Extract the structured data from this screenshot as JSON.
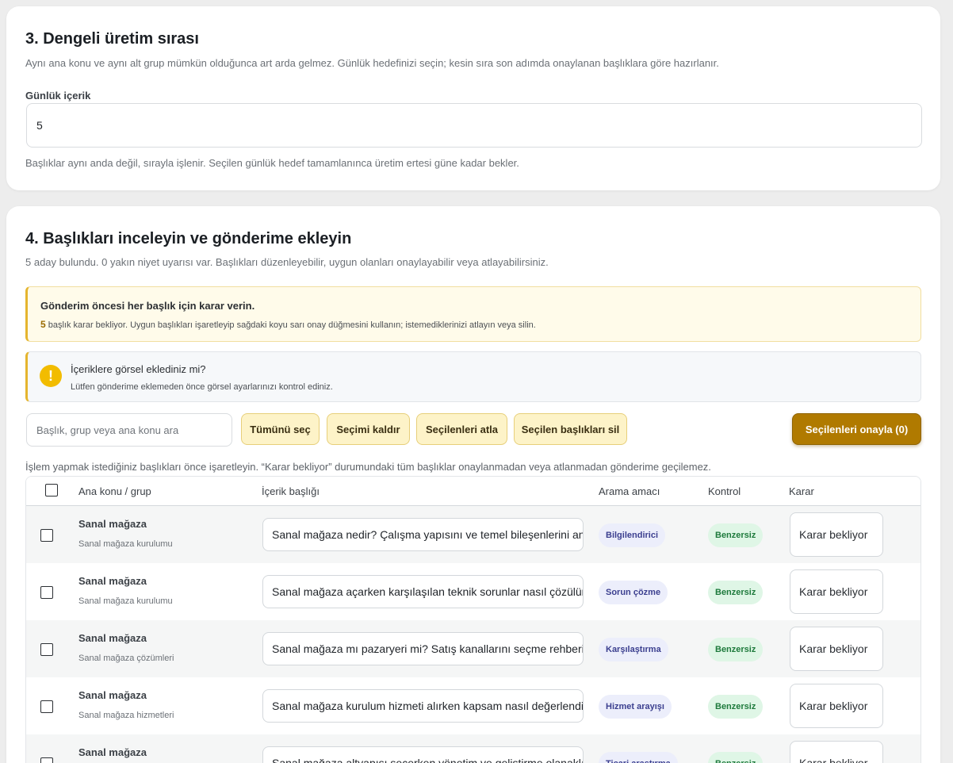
{
  "section3": {
    "title": "3. Dengeli üretim sırası",
    "description": "Aynı ana konu ve aynı alt grup mümkün olduğunca art arda gelmez. Günlük hedefinizi seçin; kesin sıra son adımda onaylanan başlıklara göre hazırlanır.",
    "daily_label": "Günlük içerik",
    "daily_value": "5",
    "note": "Başlıklar aynı anda değil, sırayla işlenir. Seçilen günlük hedef tamamlanınca üretim ertesi güne kadar bekler."
  },
  "section4": {
    "title": "4. Başlıkları inceleyin ve gönderime ekleyin",
    "description": "5 aday bulundu. 0 yakın niyet uyarısı var. Başlıkları düzenleyebilir, uygun olanları onaylayabilir veya atlayabilirsiniz.",
    "warning": {
      "title": "Gönderim öncesi her başlık için karar verin.",
      "count": "5",
      "text": "başlık karar bekliyor. Uygun başlıkları işaretleyip sağdaki koyu sarı onay düğmesini kullanın; istemediklerinizi atlayın veya silin."
    },
    "info": {
      "icon": "exclamation-icon",
      "title": "İçeriklere görsel eklediniz mi?",
      "text": "Lütfen gönderime eklemeden önce görsel ayarlarınızı kontrol ediniz."
    },
    "search_placeholder": "Başlık, grup veya ana konu ara",
    "buttons": {
      "select_all": "Tümünü seç",
      "clear_selection": "Seçimi kaldır",
      "skip_selected": "Seçilenleri atla",
      "delete_selected": "Seçilen başlıkları sil",
      "approve_selected": "Seçilenleri onayla (0)"
    },
    "hint": "İşlem yapmak istediğiniz başlıkları önce işaretleyin. “Karar bekliyor” durumundaki tüm başlıklar onaylanmadan veya atlanmadan gönderime geçilemez.",
    "table": {
      "headers": [
        "Ana konu / grup",
        "İçerik başlığı",
        "Arama amacı",
        "Kontrol",
        "Karar"
      ],
      "rows": [
        {
          "topic": "Sanal mağaza",
          "group": "Sanal mağaza kurulumu",
          "title": "Sanal mağaza nedir? Çalışma yapısını ve temel bileşenlerini anlatın",
          "intent": "Bilgilendirici",
          "check": "Benzersiz",
          "decision": "Karar bekliyor"
        },
        {
          "topic": "Sanal mağaza",
          "group": "Sanal mağaza kurulumu",
          "title": "Sanal mağaza açarken karşılaşılan teknik sorunlar nasıl çözülür?",
          "intent": "Sorun çözme",
          "check": "Benzersiz",
          "decision": "Karar bekliyor"
        },
        {
          "topic": "Sanal mağaza",
          "group": "Sanal mağaza çözümleri",
          "title": "Sanal mağaza mı pazaryeri mi? Satış kanallarını seçme rehberi",
          "intent": "Karşılaştırma",
          "check": "Benzersiz",
          "decision": "Karar bekliyor"
        },
        {
          "topic": "Sanal mağaza",
          "group": "Sanal mağaza hizmetleri",
          "title": "Sanal mağaza kurulum hizmeti alırken kapsam nasıl değerlendirilir?",
          "intent": "Hizmet arayışı",
          "check": "Benzersiz",
          "decision": "Karar bekliyor"
        },
        {
          "topic": "Sanal mağaza",
          "group": "",
          "title": "Sanal mağaza altyapısı seçerken yönetim ve geliştirme olanakları",
          "intent": "Ticari araştırma",
          "check": "Benzersiz",
          "decision": "Karar bekliyor"
        }
      ]
    }
  }
}
